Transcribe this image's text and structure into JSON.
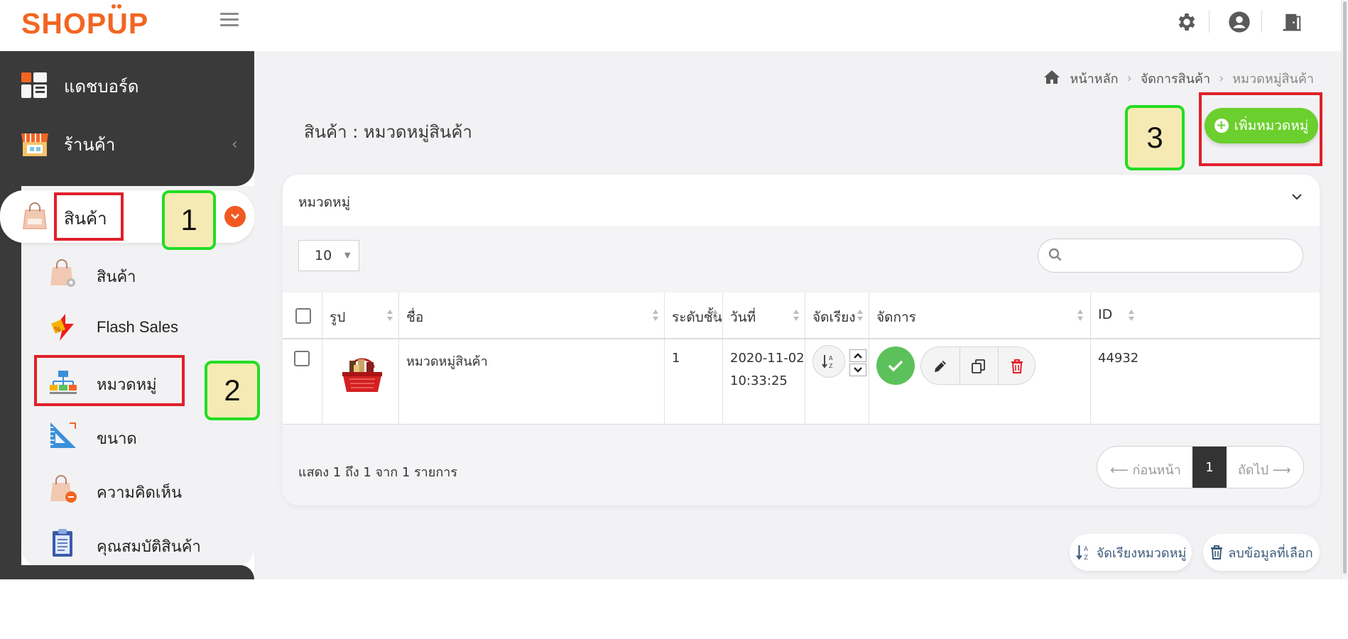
{
  "brand": {
    "logo_text": "SHOPUP",
    "accent": "#f26522"
  },
  "topbar": {
    "icons": [
      "menu-icon",
      "gear-icon",
      "user-icon",
      "exit-door-icon"
    ]
  },
  "sidebar": {
    "dashboard": "แดชบอร์ด",
    "store": "ร้านค้า",
    "products_group": "สินค้า",
    "sub_items": [
      {
        "label": "สินค้า",
        "icon": "product-bag-icon"
      },
      {
        "label": "Flash Sales",
        "icon": "flash-icon"
      },
      {
        "label": "หมวดหมู่",
        "icon": "category-tree-icon"
      },
      {
        "label": "ขนาด",
        "icon": "ruler-icon"
      },
      {
        "label": "ความคิดเห็น",
        "icon": "comment-bag-icon"
      },
      {
        "label": "คุณสมบัติสินค้า",
        "icon": "clipboard-icon"
      }
    ]
  },
  "annotations": {
    "n1": "1",
    "n2": "2",
    "n3": "3"
  },
  "breadcrumb": {
    "home": "หน้าหลัก",
    "middle": "จัดการสินค้า",
    "current": "หมวดหมู่สินค้า"
  },
  "page": {
    "title": "สินค้า : หมวดหมู่สินค้า",
    "add_button": "เพิ่มหมวดหมู่"
  },
  "card": {
    "title": "หมวดหมู่",
    "page_size": "10",
    "search_placeholder": "",
    "columns": [
      "รูป",
      "ชื่อ",
      "ระดับชั้น",
      "วันที่",
      "จัดเรียง",
      "จัดการ",
      "ID"
    ],
    "rows": [
      {
        "name": "หมวดหมู่สินค้า",
        "level": "1",
        "date": "2020-11-02",
        "time": "10:33:25",
        "id": "44932"
      }
    ],
    "footer_info": "แสดง 1 ถึง 1 จาก 1 รายการ",
    "pager": {
      "prev": "⟵ ก่อนหน้า",
      "current": "1",
      "next": "ถัดไป ⟶"
    }
  },
  "bottom_buttons": {
    "sort": "จัดเรียงหมวดหมู่",
    "delete": "ลบข้อมูลที่เลือก"
  }
}
